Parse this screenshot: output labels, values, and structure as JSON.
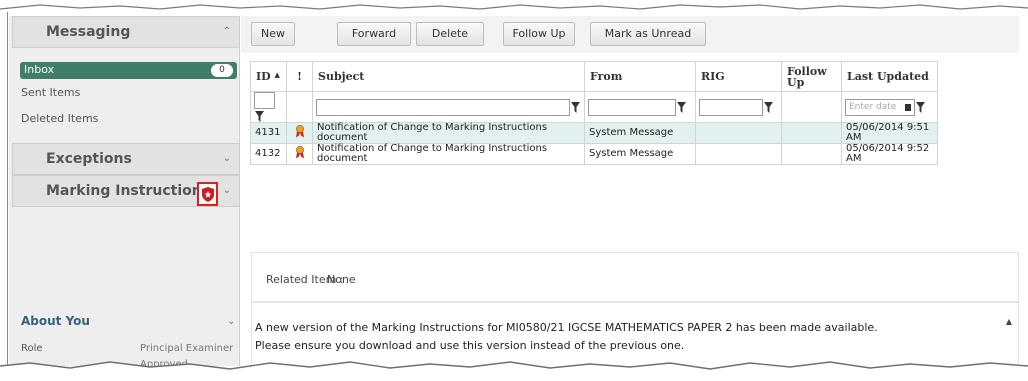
{
  "sidebar": {
    "messaging": {
      "title": "Messaging",
      "chevron": "chevron-up-icon"
    },
    "inbox": {
      "label": "Inbox",
      "count": "0"
    },
    "sent_items": "Sent Items",
    "deleted_items": "Deleted Items",
    "exceptions": {
      "title": "Exceptions",
      "chevron": "chevron-down-icon"
    },
    "marking_instructions": {
      "title": "Marking Instructions",
      "icon": "alert-shield-icon",
      "chevron": "chevron-down-icon"
    },
    "about": {
      "title": "About You",
      "role_label": "Role",
      "role_value": "Principal Examiner",
      "status": "Approved"
    }
  },
  "toolbar": {
    "new": "New",
    "forward": "Forward",
    "delete": "Delete",
    "follow_up": "Follow Up",
    "mark_unread": "Mark as Unread"
  },
  "grid": {
    "headers": {
      "id": "ID",
      "importance": "!",
      "subject": "Subject",
      "from": "From",
      "rig": "RIG",
      "follow_up": "Follow Up",
      "last_updated": "Last Updated"
    },
    "date_filter_placeholder": "Enter date",
    "rows": [
      {
        "id": "4131",
        "subject": "Notification of Change to Marking Instructions document",
        "from": "System Message",
        "rig": "",
        "follow_up": "",
        "last_updated": "05/06/2014 9:51 AM"
      },
      {
        "id": "4132",
        "subject": "Notification of Change to Marking Instructions document",
        "from": "System Message",
        "rig": "",
        "follow_up": "",
        "last_updated": "05/06/2014 9:52 AM"
      }
    ]
  },
  "detail": {
    "related_label": "Related Item :",
    "related_value": "None",
    "body_line1": "A new version of the Marking Instructions for  MI0580/21 IGCSE MATHEMATICS PAPER 2 has been made available.",
    "body_line2": "Please ensure you download and use this version instead of the previous one."
  },
  "colors": {
    "accent": "#3f7f6a",
    "selected_row": "#e1f1ef",
    "highlight_border": "#e02020",
    "about_title": "#35637a"
  }
}
